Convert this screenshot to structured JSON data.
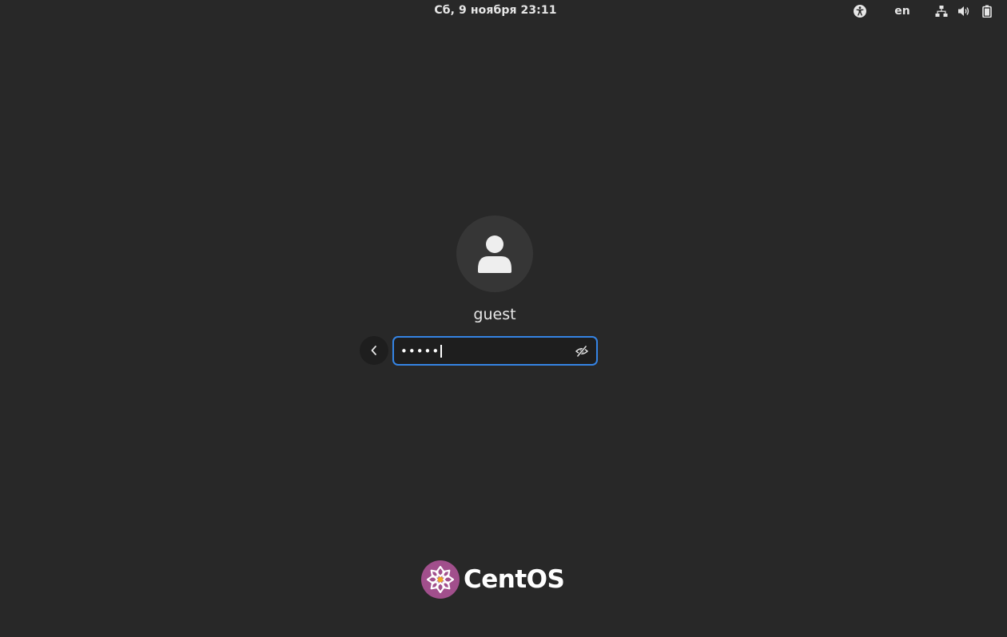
{
  "topbar": {
    "datetime": "Сб, 9 ноября  23:11",
    "language": "en",
    "icons": {
      "accessibility": "accessibility-icon",
      "network": "network-wired-icon",
      "volume": "volume-icon",
      "battery": "battery-icon"
    }
  },
  "login": {
    "username": "guest",
    "password_mask": "•••••",
    "back_icon": "chevron-left-icon",
    "reveal_icon": "eye-slash-icon",
    "accent_color": "#3584e4"
  },
  "branding": {
    "logo_text": "CentOS",
    "logo_color": "#a14f8c"
  }
}
